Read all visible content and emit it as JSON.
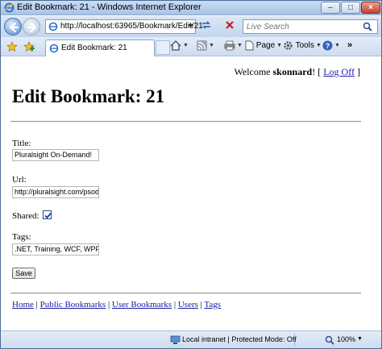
{
  "window": {
    "title": "Edit Bookmark: 21 - Windows Internet Explorer"
  },
  "address_bar": {
    "url": "http://localhost:63965/Bookmark/Edit/21"
  },
  "search": {
    "placeholder": "Live Search"
  },
  "tab": {
    "label": "Edit Bookmark: 21"
  },
  "command_bar": {
    "page_label": "Page",
    "tools_label": "Tools"
  },
  "page": {
    "welcome_prefix": "Welcome ",
    "username": "skonnard",
    "welcome_suffix": "! [ ",
    "logoff_label": "Log Off",
    "bracket_close": " ]",
    "heading": "Edit Bookmark: 21",
    "title_label": "Title:",
    "title_value": "Pluralsight On-Demand!",
    "url_label": "Url:",
    "url_value": "http://pluralsight.com/psod",
    "shared_label": "Shared:",
    "shared_checked": true,
    "tags_label": "Tags:",
    "tags_value": ".NET, Training, WCF, WPF",
    "save_label": "Save"
  },
  "footer_nav": {
    "items": [
      {
        "label": "Home"
      },
      {
        "label": "Public Bookmarks"
      },
      {
        "label": "User Bookmarks"
      },
      {
        "label": "Users"
      },
      {
        "label": "Tags"
      }
    ],
    "separator": " | "
  },
  "status_bar": {
    "zone": "Local intranet | Protected Mode: Off",
    "zoom": "100%"
  },
  "colors": {
    "link": "#1a1aa6",
    "chrome": "#c9dcf3"
  }
}
